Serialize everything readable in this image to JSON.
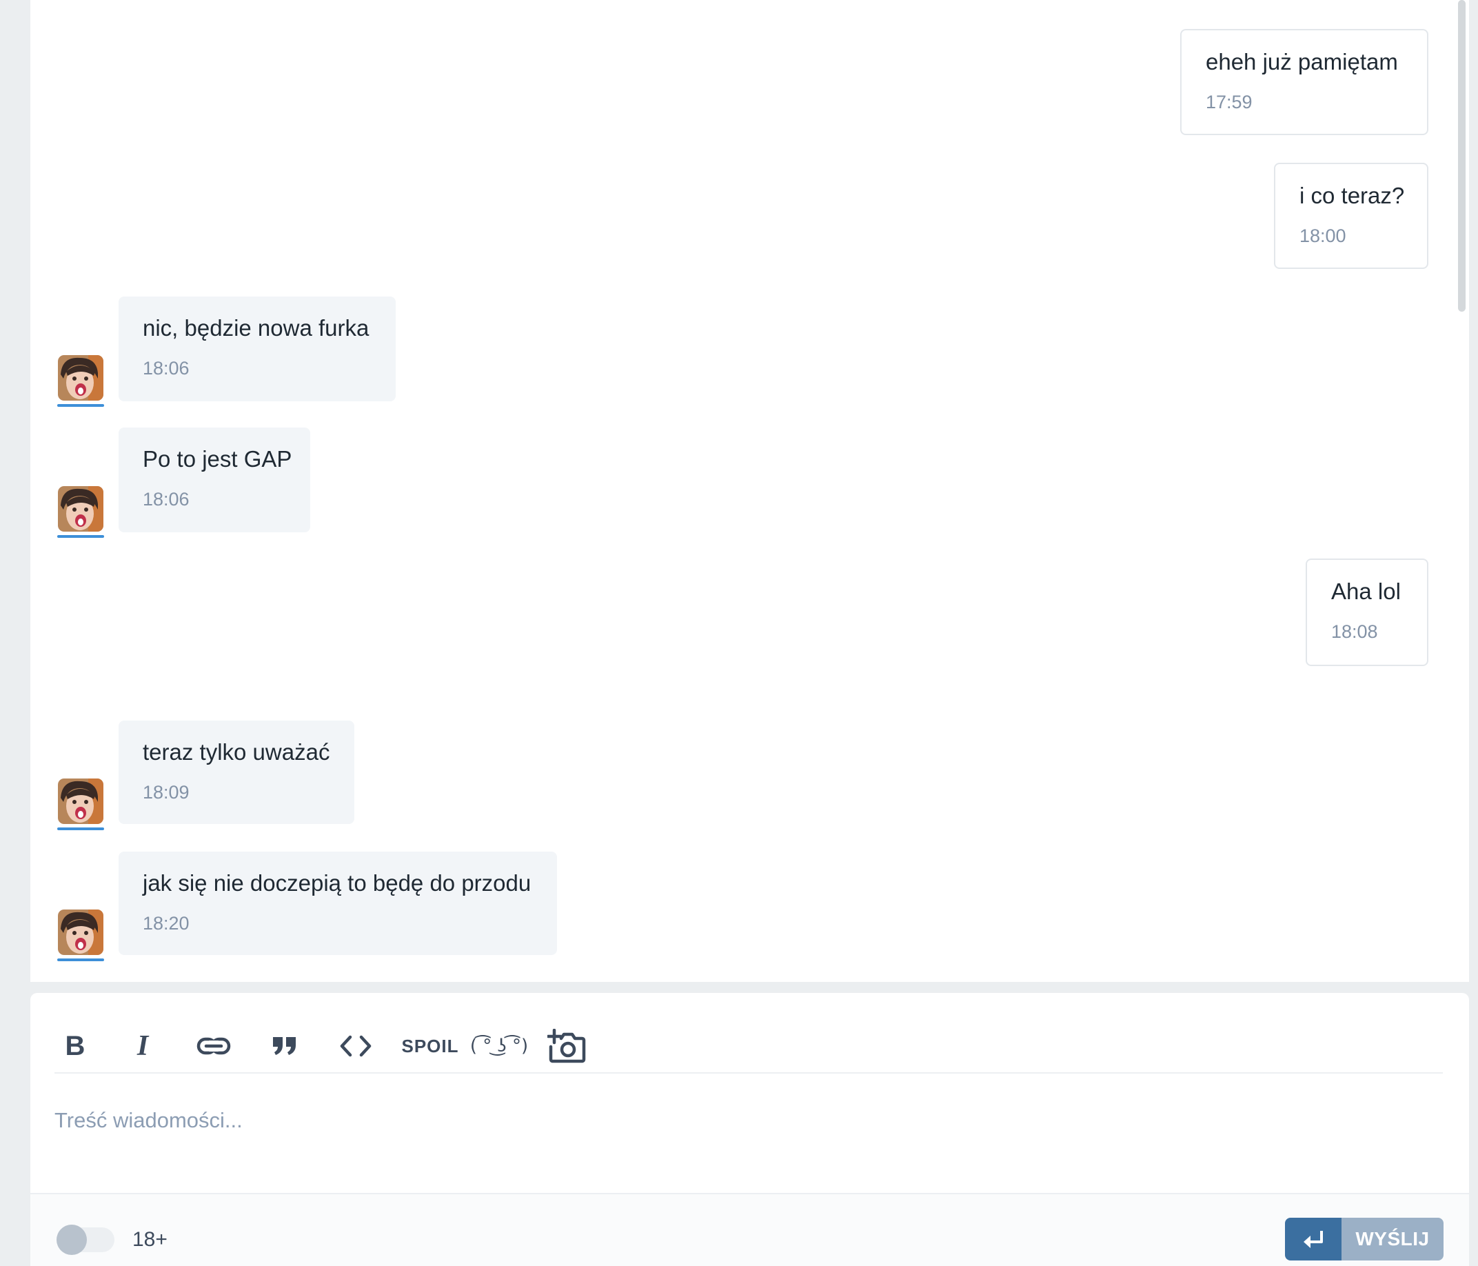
{
  "messages": [
    {
      "direction": "out",
      "text": "eheh już pamiętam",
      "time": "17:59"
    },
    {
      "direction": "out",
      "text": "i co teraz?",
      "time": "18:00"
    },
    {
      "direction": "in",
      "text": "nic, będzie nowa furka",
      "time": "18:06"
    },
    {
      "direction": "in",
      "text": "Po to jest GAP",
      "time": "18:06"
    },
    {
      "direction": "out",
      "text": "Aha lol",
      "time": "18:08"
    },
    {
      "direction": "in",
      "text": "teraz tylko uważać",
      "time": "18:09"
    },
    {
      "direction": "in",
      "text": "jak się nie doczepią to będę do przodu",
      "time": "18:20"
    }
  ],
  "toolbar": {
    "bold": "B",
    "italic": "I",
    "spoiler": "SPOIL",
    "lenny": "( ͡° ͜ʖ ͡°)"
  },
  "composer": {
    "placeholder": "Treść wiadomości...",
    "adult_label": "18+",
    "send_label": "WYŚLIJ",
    "send_icon": "↵"
  },
  "colors": {
    "accent": "#3b6fa0",
    "send_label_bg": "#9bb0c6",
    "avatar_underline": "#3d8fd8",
    "incoming_bubble": "#f2f5f8",
    "timestamp": "#8392a6"
  }
}
